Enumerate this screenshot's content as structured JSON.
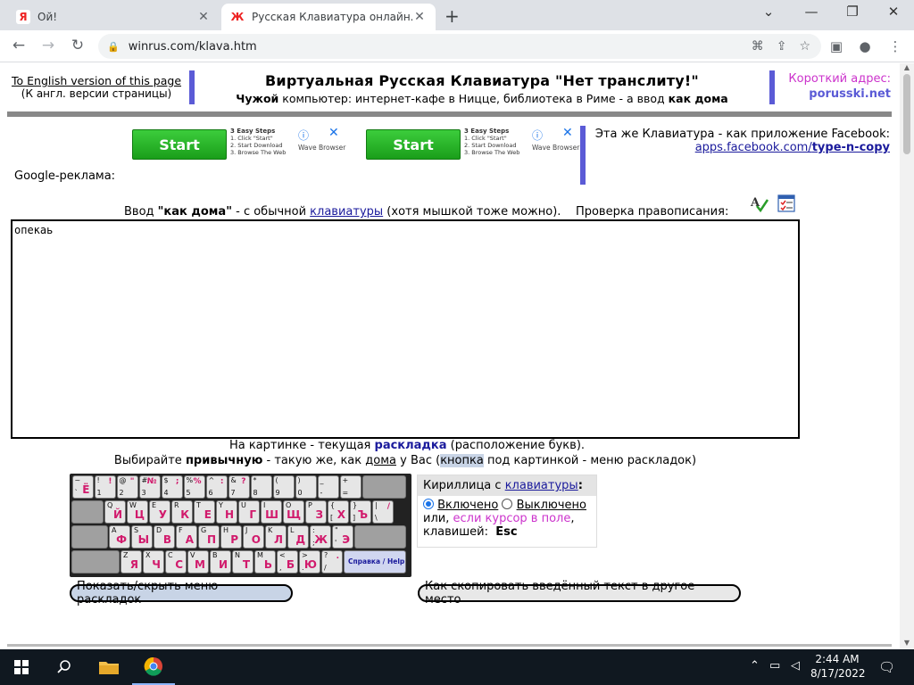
{
  "browser": {
    "tabs": [
      {
        "title": "Ой!",
        "favicon": "Я"
      },
      {
        "title": "Русская Клавиатура онлайн. Ви",
        "favicon": "Ж"
      }
    ],
    "url": "winrus.com/klava.htm"
  },
  "header": {
    "english_link": "To English version of this page",
    "english_sub": "(К англ. версии страницы)",
    "title": "Виртуальная Русская Клавиатура \"Нет транслиту!\"",
    "subtitle_bold1": "Чужой",
    "subtitle_mid": " компьютер: интернет-кафе в Ницце, библиотека в Риме - а ввод ",
    "subtitle_bold2": "как дома",
    "short_address_label": "Короткий адрес:",
    "short_address": "porusski.net"
  },
  "ads": [
    {
      "button": "Start",
      "steps_title": "3 Easy Steps",
      "step1": "1. Click \"Start\"",
      "step2": "2. Start Download",
      "step3": "3. Browse The Web",
      "brand": "Wave Browser"
    },
    {
      "button": "Start",
      "steps_title": "3 Easy Steps",
      "step1": "1. Click \"Start\"",
      "step2": "2. Start Download",
      "step3": "3. Browse The Web",
      "brand": "Wave Browser"
    }
  ],
  "facebook": {
    "text": "Эта же Клавиатура - как приложение Facebook:",
    "link_prefix": "apps.facebook.com/",
    "link_bold": "type-n-copy"
  },
  "google_ads_label": "Google-реклама:",
  "input_line": {
    "prefix": "Ввод ",
    "bold": "\"как дома\"",
    "mid": " - с обычной ",
    "link": "клавиатуры",
    "suffix": " (хотя мышкой тоже можно).",
    "spell": "Проверка правописания:"
  },
  "textarea_value": "опекаь",
  "captions": {
    "line1_prefix": "На картинке - текущая ",
    "line1_em": "раскладка",
    "line1_suffix": " (расположение букв).",
    "line2_prefix": "Выбирайте ",
    "line2_bold": "привычную",
    "line2_mid": " - такую же, как ",
    "line2_ul": "дома",
    "line2_mid2": " у Вас (",
    "line2_hl": "кнопка",
    "line2_suffix": " под картинкой - меню раскладок)"
  },
  "keyboard": {
    "row1": [
      {
        "t": "~",
        "b": "`",
        "r": "Ё"
      },
      {
        "t": "!",
        "b": "1",
        "r": "!"
      },
      {
        "t": "@",
        "b": "2",
        "r": "\""
      },
      {
        "t": "#",
        "b": "3",
        "r": "№"
      },
      {
        "t": "$",
        "b": "4",
        "r": ";"
      },
      {
        "t": "%",
        "b": "5",
        "r": "%"
      },
      {
        "t": "^",
        "b": "6",
        "r": ":"
      },
      {
        "t": "&",
        "b": "7",
        "r": "?"
      },
      {
        "t": "*",
        "b": "8",
        "r": ""
      },
      {
        "t": "(",
        "b": "9",
        "r": ""
      },
      {
        "t": ")",
        "b": "0",
        "r": ""
      },
      {
        "t": "_",
        "b": "-",
        "r": ""
      },
      {
        "t": "+",
        "b": "=",
        "r": ""
      }
    ],
    "row2": [
      {
        "t": "Q",
        "r": "Й"
      },
      {
        "t": "W",
        "r": "Ц"
      },
      {
        "t": "E",
        "r": "У"
      },
      {
        "t": "R",
        "r": "К"
      },
      {
        "t": "T",
        "r": "Е"
      },
      {
        "t": "Y",
        "r": "Н"
      },
      {
        "t": "U",
        "r": "Г"
      },
      {
        "t": "I",
        "r": "Ш"
      },
      {
        "t": "O",
        "r": "Щ"
      },
      {
        "t": "P",
        "r": "З"
      },
      {
        "t": "{",
        "b": "[",
        "r": "Х"
      },
      {
        "t": "}",
        "b": "]",
        "r": "Ъ"
      },
      {
        "t": "|",
        "b": "\\",
        "r": "/"
      }
    ],
    "row3": [
      {
        "t": "A",
        "r": "Ф"
      },
      {
        "t": "S",
        "r": "Ы"
      },
      {
        "t": "D",
        "r": "В"
      },
      {
        "t": "F",
        "r": "А"
      },
      {
        "t": "G",
        "r": "П"
      },
      {
        "t": "H",
        "r": "Р"
      },
      {
        "t": "J",
        "r": "О"
      },
      {
        "t": "K",
        "r": "Л"
      },
      {
        "t": "L",
        "r": "Д"
      },
      {
        "t": ":",
        "b": ";",
        "r": "Ж"
      },
      {
        "t": "\"",
        "b": "'",
        "r": "Э"
      }
    ],
    "row4": [
      {
        "t": "Z",
        "r": "Я"
      },
      {
        "t": "X",
        "r": "Ч"
      },
      {
        "t": "C",
        "r": "С"
      },
      {
        "t": "V",
        "r": "М"
      },
      {
        "t": "B",
        "r": "И"
      },
      {
        "t": "N",
        "r": "Т"
      },
      {
        "t": "M",
        "r": "Ь"
      },
      {
        "t": "<",
        "b": ",",
        "r": "Б"
      },
      {
        "t": ">",
        "b": ".",
        "r": "Ю"
      },
      {
        "t": "?",
        "b": "/",
        "r": "."
      }
    ],
    "help": "Справка / Help"
  },
  "cyrillic": {
    "head_prefix": "Кириллица с ",
    "head_link": "клавиатуры",
    "head_suffix": ":",
    "on": "Включено",
    "off": "Выключено",
    "or": "или, ",
    "pink": "если курсор в поле",
    "comma": ",",
    "key_label": "клавишей:",
    "key": "Esc"
  },
  "buttons": {
    "layouts": "Показать/скрыть меню раскладок",
    "copy": "Как скопировать введённый текст в другое место"
  },
  "taskbar": {
    "time": "2:44 AM",
    "date": "8/17/2022"
  }
}
